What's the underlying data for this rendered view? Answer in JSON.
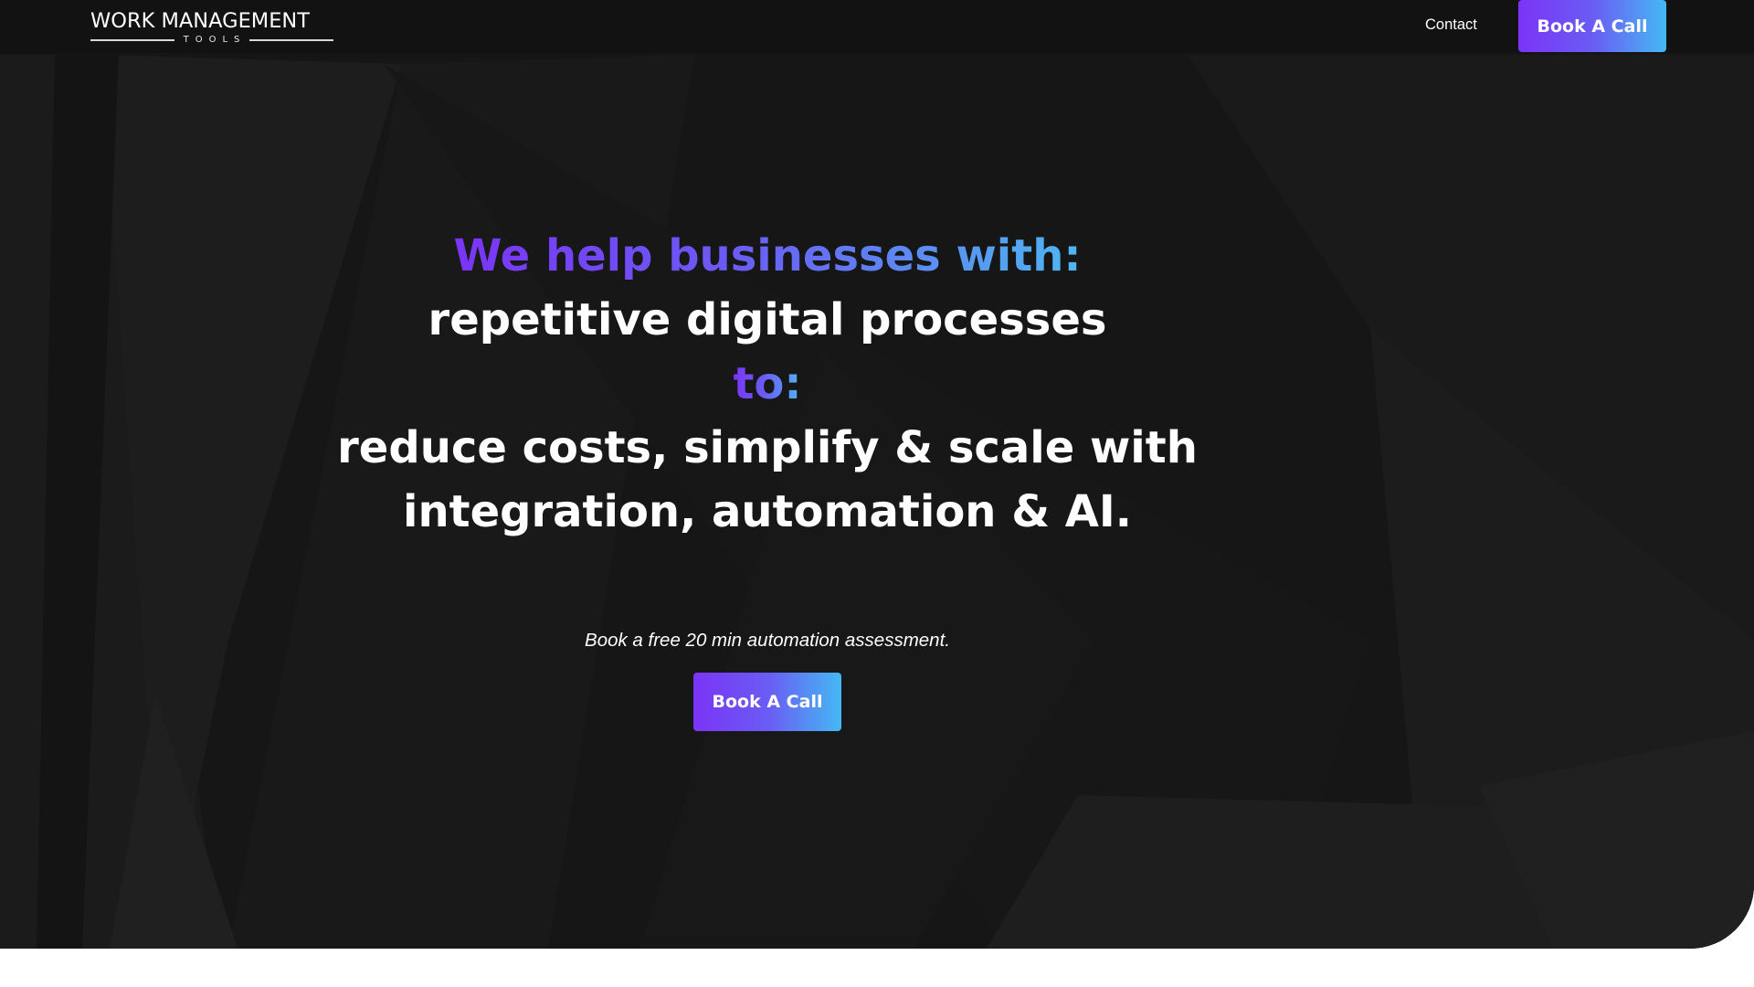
{
  "header": {
    "logo_main": "WORK MANAGEMENT",
    "logo_sub": "TOOLS",
    "nav_contact": "Contact",
    "cta_label": "Book A Call"
  },
  "hero": {
    "heading_line1": "We help businesses with:",
    "heading_line2": "repetitive digital processes",
    "heading_line3": "to:",
    "heading_line4": "reduce costs, simplify & scale with",
    "heading_line5": "integration, automation & AI.",
    "subtext": "Book a free 20 min automation assessment.",
    "cta_label": "Book A Call"
  },
  "colors": {
    "background": "#161616",
    "header_bg": "#121212",
    "accent_purple": "#7b34f6",
    "accent_blue": "#45b8f4",
    "text": "#ffffff"
  }
}
